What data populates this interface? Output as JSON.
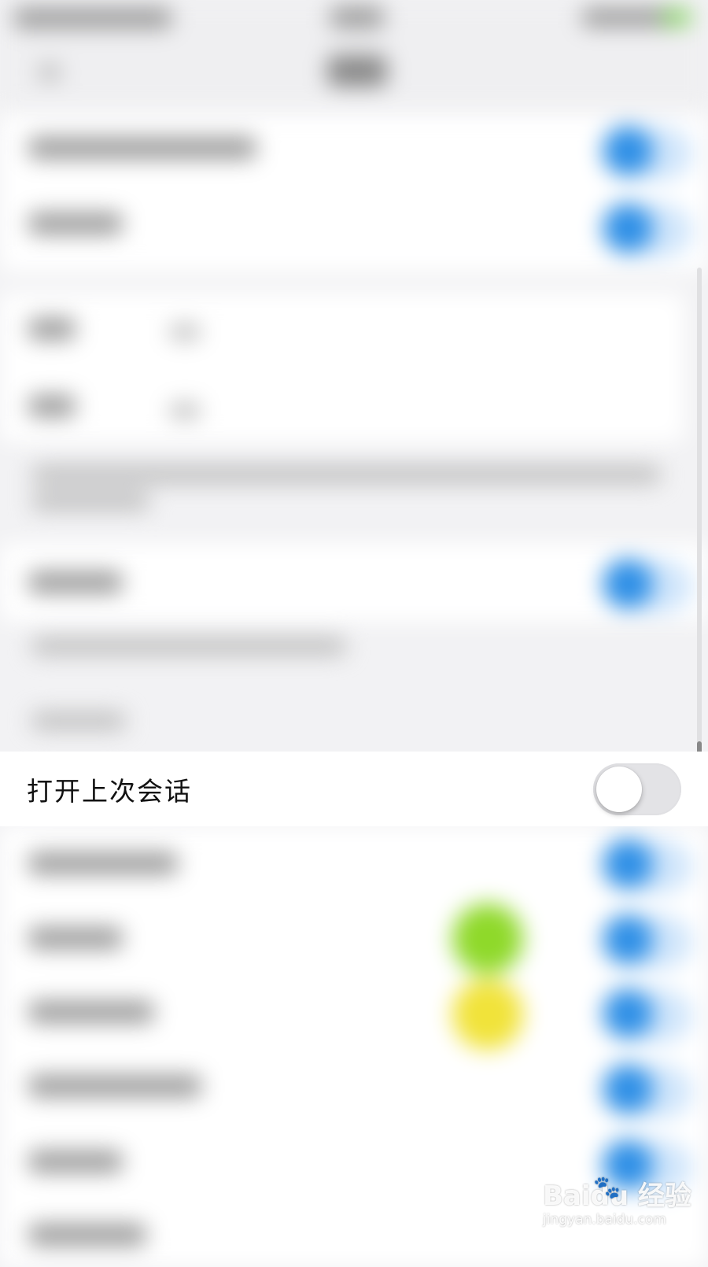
{
  "focus_row": {
    "label": "打开上次会话",
    "toggle_state": "off"
  },
  "watermark": {
    "brand_left": "Bai",
    "brand_right": "du 经验",
    "url": "jingyan.baidu.com"
  },
  "colors": {
    "switch_on": "#2e8fe6",
    "switch_off_track": "#e3e3e6",
    "green_dot": "#8fd92a",
    "yellow_dot": "#f1e33a"
  }
}
